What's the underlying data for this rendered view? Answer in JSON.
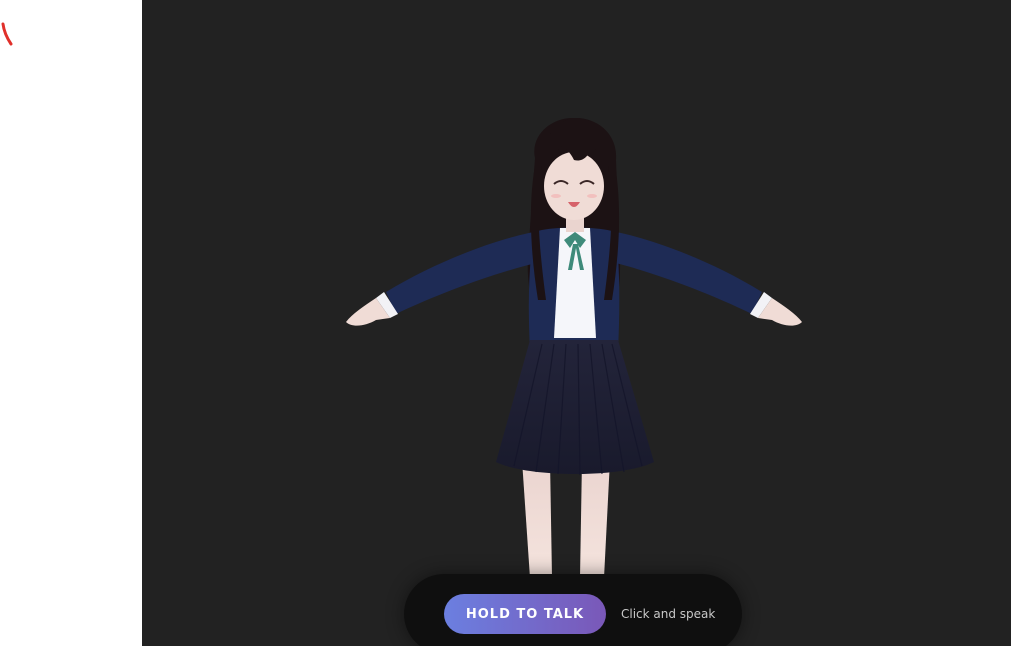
{
  "left_panel": {
    "background": "#ffffff",
    "mark_color": "#e0302a"
  },
  "viewport": {
    "background": "#222222"
  },
  "avatar": {
    "icon": "anime-schoolgirl-3d-model",
    "hair_color": "#1c1214",
    "jacket_color": "#1e2b55",
    "skirt_color": "#1c1d30",
    "ribbon_color": "#3e8a7a",
    "skin_color": "#f0dcd6"
  },
  "talk_bar": {
    "button_label": "HOLD TO TALK",
    "hint_text": "Click and speak",
    "button_gradient_start": "#6b7fe0",
    "button_gradient_end": "#7a58b8"
  }
}
